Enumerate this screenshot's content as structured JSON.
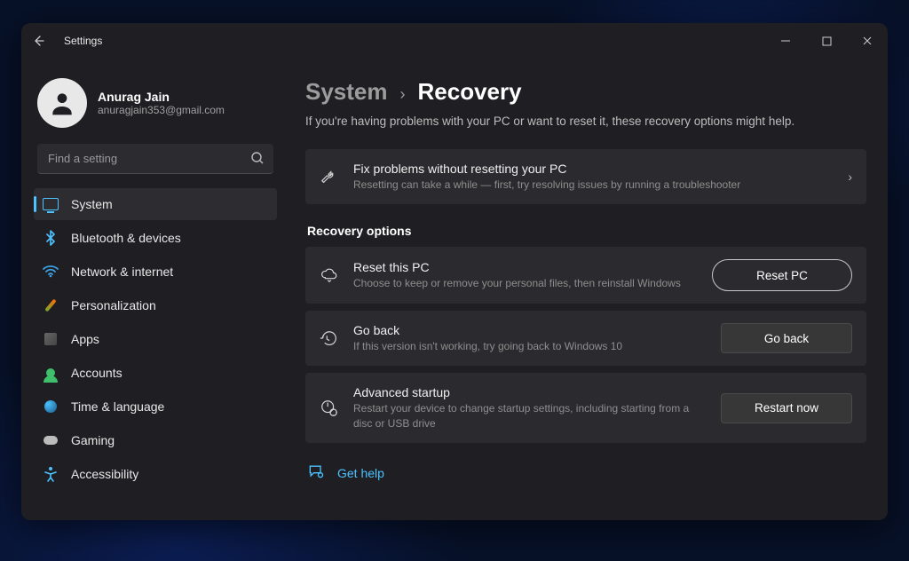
{
  "window": {
    "title": "Settings"
  },
  "user": {
    "name": "Anurag Jain",
    "email": "anuragjain353@gmail.com"
  },
  "search": {
    "placeholder": "Find a setting"
  },
  "sidebar": {
    "items": [
      {
        "label": "System"
      },
      {
        "label": "Bluetooth & devices"
      },
      {
        "label": "Network & internet"
      },
      {
        "label": "Personalization"
      },
      {
        "label": "Apps"
      },
      {
        "label": "Accounts"
      },
      {
        "label": "Time & language"
      },
      {
        "label": "Gaming"
      },
      {
        "label": "Accessibility"
      }
    ]
  },
  "breadcrumb": {
    "parent": "System",
    "sep": "›",
    "current": "Recovery"
  },
  "subtitle": "If you're having problems with your PC or want to reset it, these recovery options might help.",
  "troubleshoot": {
    "title": "Fix problems without resetting your PC",
    "desc": "Resetting can take a while — first, try resolving issues by running a troubleshooter"
  },
  "section_label": "Recovery options",
  "cards": {
    "reset": {
      "title": "Reset this PC",
      "desc": "Choose to keep or remove your personal files, then reinstall Windows",
      "button": "Reset PC"
    },
    "goback": {
      "title": "Go back",
      "desc": "If this version isn't working, try going back to Windows 10",
      "button": "Go back"
    },
    "startup": {
      "title": "Advanced startup",
      "desc": "Restart your device to change startup settings, including starting from a disc or USB drive",
      "button": "Restart now"
    }
  },
  "help": {
    "label": "Get help"
  }
}
